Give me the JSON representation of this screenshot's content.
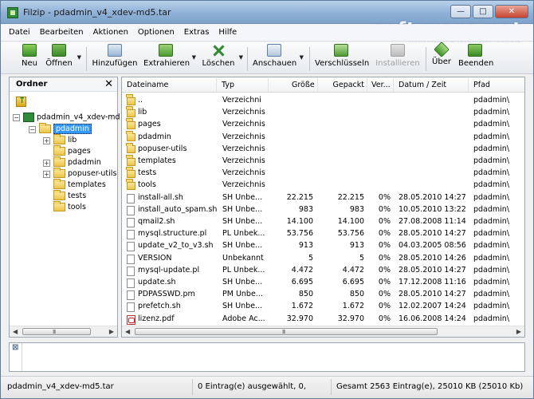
{
  "window": {
    "title": "Filzip - pdadmin_v4_xdev-md5.tar",
    "minimize": "—",
    "maximize": "□",
    "close": "✕"
  },
  "watermark": {
    "brand": "soft ware.net",
    "sub": "AKTUELLE DOWNLOADS"
  },
  "menu": [
    "Datei",
    "Bearbeiten",
    "Aktionen",
    "Optionen",
    "Extras",
    "Hilfe"
  ],
  "toolbar": {
    "new": "Neu",
    "open": "Öffnen",
    "add": "Hinzufügen",
    "extract": "Extrahieren",
    "delete": "Löschen",
    "view": "Anschauen",
    "encrypt": "Verschlüsseln",
    "install": "Installieren",
    "about": "Über",
    "exit": "Beenden"
  },
  "folders_panel": {
    "title": "Ordner",
    "close": "✕",
    "tree": {
      "root": "pdadmin_v4_xdev-md",
      "selected": "pdadmin",
      "children": [
        "lib",
        "pages",
        "pdadmin",
        "popuser-utils",
        "templates",
        "tests",
        "tools"
      ]
    }
  },
  "columns": {
    "name": "Dateiname",
    "type": "Typ",
    "size": "Größe",
    "packed": "Gepackt",
    "ratio": "Ver...",
    "date": "Datum / Zeit",
    "path": "Pfad"
  },
  "files": [
    {
      "name": "..",
      "type": "Verzeichni",
      "size": "",
      "packed": "",
      "ratio": "",
      "date": "",
      "path": "pdadmin\\",
      "icon": "folder"
    },
    {
      "name": "lib",
      "type": "Verzeichnis",
      "size": "",
      "packed": "",
      "ratio": "",
      "date": "",
      "path": "pdadmin\\",
      "icon": "folder"
    },
    {
      "name": "pages",
      "type": "Verzeichnis",
      "size": "",
      "packed": "",
      "ratio": "",
      "date": "",
      "path": "pdadmin\\",
      "icon": "folder"
    },
    {
      "name": "pdadmin",
      "type": "Verzeichnis",
      "size": "",
      "packed": "",
      "ratio": "",
      "date": "",
      "path": "pdadmin\\",
      "icon": "folder"
    },
    {
      "name": "popuser-utils",
      "type": "Verzeichnis",
      "size": "",
      "packed": "",
      "ratio": "",
      "date": "",
      "path": "pdadmin\\",
      "icon": "folder"
    },
    {
      "name": "templates",
      "type": "Verzeichnis",
      "size": "",
      "packed": "",
      "ratio": "",
      "date": "",
      "path": "pdadmin\\",
      "icon": "folder"
    },
    {
      "name": "tests",
      "type": "Verzeichnis",
      "size": "",
      "packed": "",
      "ratio": "",
      "date": "",
      "path": "pdadmin\\",
      "icon": "folder"
    },
    {
      "name": "tools",
      "type": "Verzeichnis",
      "size": "",
      "packed": "",
      "ratio": "",
      "date": "",
      "path": "pdadmin\\",
      "icon": "folder"
    },
    {
      "name": "install-all.sh",
      "type": "SH Unbe...",
      "size": "22.215",
      "packed": "22.215",
      "ratio": "0%",
      "date": "28.05.2010 14:27",
      "path": "pdadmin\\",
      "icon": "file"
    },
    {
      "name": "install_auto_spam.sh",
      "type": "SH Unbe...",
      "size": "983",
      "packed": "983",
      "ratio": "0%",
      "date": "10.05.2010 13:22",
      "path": "pdadmin\\",
      "icon": "file"
    },
    {
      "name": "qmail2.sh",
      "type": "SH Unbe...",
      "size": "14.100",
      "packed": "14.100",
      "ratio": "0%",
      "date": "27.08.2008 11:14",
      "path": "pdadmin\\",
      "icon": "file"
    },
    {
      "name": "mysql.structure.pl",
      "type": "PL Unbek...",
      "size": "53.756",
      "packed": "53.756",
      "ratio": "0%",
      "date": "28.05.2010 14:27",
      "path": "pdadmin\\",
      "icon": "file"
    },
    {
      "name": "update_v2_to_v3.sh",
      "type": "SH Unbe...",
      "size": "913",
      "packed": "913",
      "ratio": "0%",
      "date": "04.03.2005 08:56",
      "path": "pdadmin\\",
      "icon": "file"
    },
    {
      "name": "VERSION",
      "type": "Unbekannt",
      "size": "5",
      "packed": "5",
      "ratio": "0%",
      "date": "28.05.2010 14:26",
      "path": "pdadmin\\",
      "icon": "file"
    },
    {
      "name": "mysql-update.pl",
      "type": "PL Unbek...",
      "size": "4.472",
      "packed": "4.472",
      "ratio": "0%",
      "date": "28.05.2010 14:27",
      "path": "pdadmin\\",
      "icon": "file"
    },
    {
      "name": "update.sh",
      "type": "SH Unbe...",
      "size": "6.695",
      "packed": "6.695",
      "ratio": "0%",
      "date": "17.12.2008 11:16",
      "path": "pdadmin\\",
      "icon": "file"
    },
    {
      "name": "PDPASSWD.pm",
      "type": "PM Unbe...",
      "size": "850",
      "packed": "850",
      "ratio": "0%",
      "date": "28.05.2010 14:27",
      "path": "pdadmin\\",
      "icon": "file"
    },
    {
      "name": "prefetch.sh",
      "type": "SH Unbe...",
      "size": "1.672",
      "packed": "1.672",
      "ratio": "0%",
      "date": "12.02.2007 14:24",
      "path": "pdadmin\\",
      "icon": "file"
    },
    {
      "name": "lizenz.pdf",
      "type": "Adobe Ac...",
      "size": "32.970",
      "packed": "32.970",
      "ratio": "0%",
      "date": "16.06.2008 14:24",
      "path": "pdadmin\\",
      "icon": "pdf"
    }
  ],
  "status": {
    "archive": "pdadmin_v4_xdev-md5.tar",
    "selection": "0 Eintrag(e) ausgewählt, 0,",
    "total": "Gesamt 2563 Eintrag(e), 25010 KB (25010 Kb)"
  },
  "log_close": "⊠",
  "scroll_grip": "III"
}
